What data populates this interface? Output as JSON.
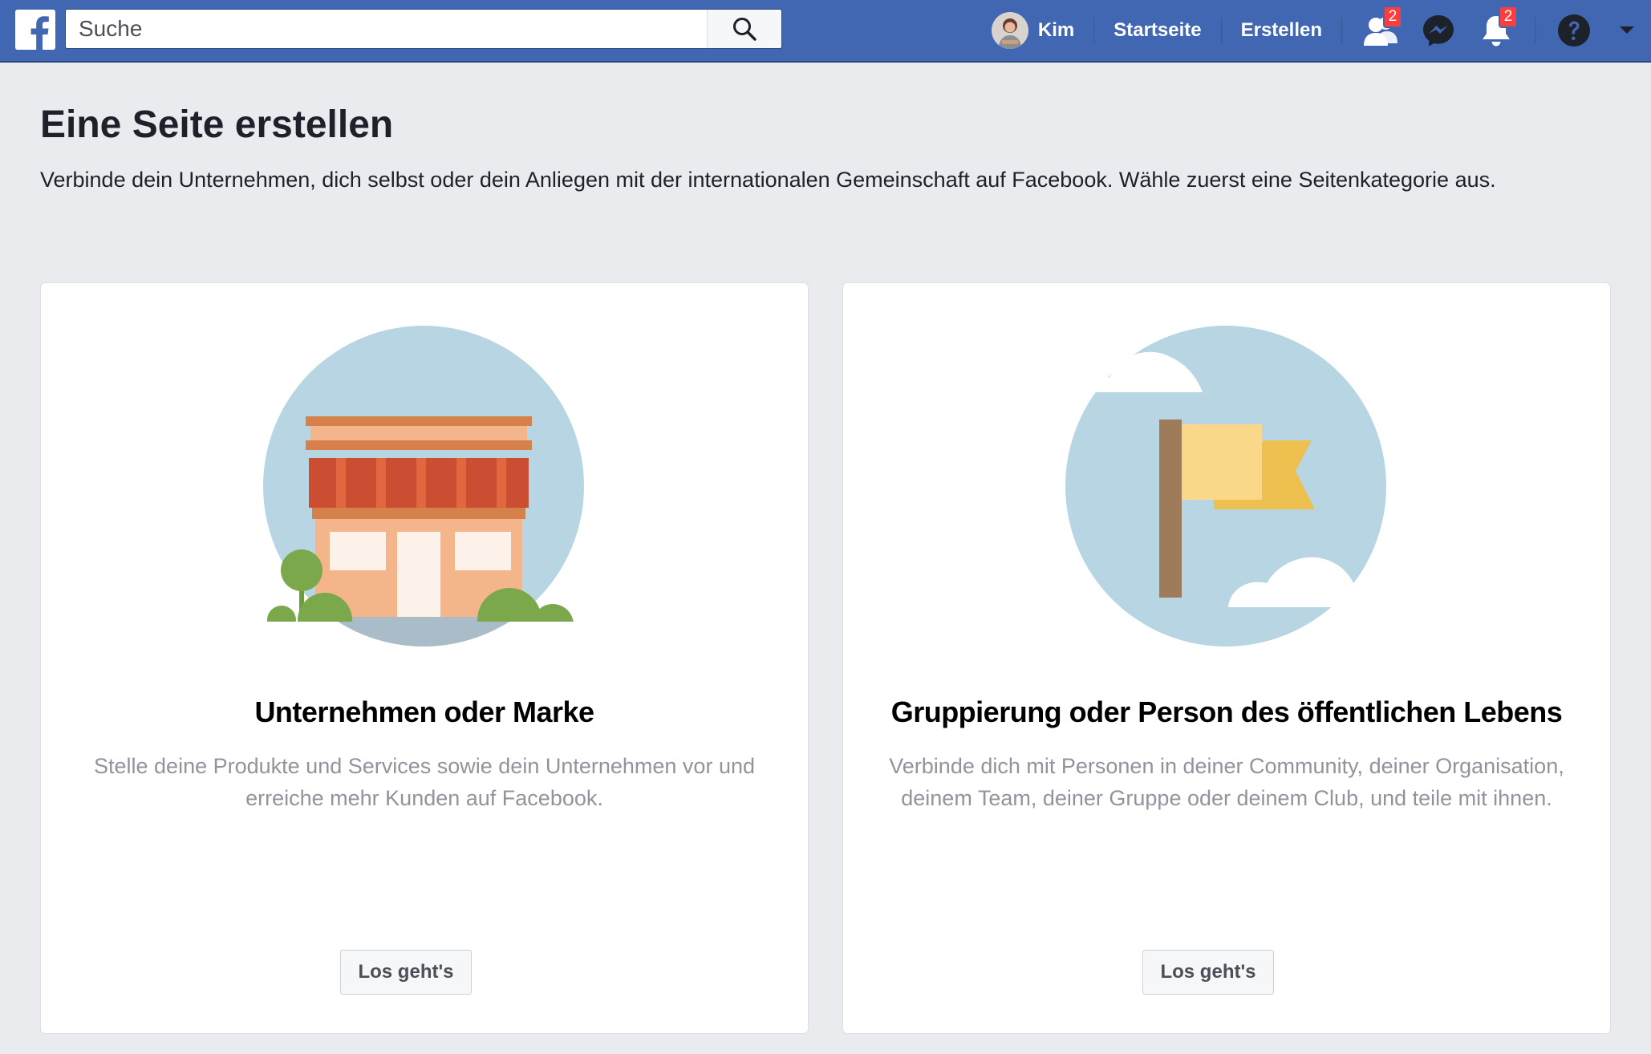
{
  "header": {
    "search_placeholder": "Suche",
    "profile_name": "Kim",
    "nav_home": "Startseite",
    "nav_create": "Erstellen",
    "friend_requests_count": "2",
    "notifications_count": "2",
    "colors": {
      "bar": "#4267b2",
      "badge": "#fa3e3e"
    },
    "icons": [
      "facebook-logo-icon",
      "search-icon",
      "friend-requests-icon",
      "messenger-icon",
      "notifications-bell-icon",
      "help-icon",
      "caret-down-icon"
    ]
  },
  "page": {
    "title": "Eine Seite erstellen",
    "subtitle": "Verbinde dein Unternehmen, dich selbst oder dein Anliegen mit der internationalen Gemeinschaft auf Facebook. Wähle zuerst eine Seitenkategorie aus."
  },
  "cards": [
    {
      "title": "Unternehmen oder Marke",
      "description": "Stelle deine Produkte und Services sowie dein Unternehmen vor und erreiche mehr Kunden auf Facebook.",
      "button": "Los geht's",
      "illustration": "storefront-illustration"
    },
    {
      "title": "Gruppierung oder Person des öffentlichen Lebens",
      "description": "Verbinde dich mit Personen in deiner Community, deiner Organisation, deinem Team, deiner Gruppe oder deinem Club, und teile mit ihnen.",
      "button": "Los geht's",
      "illustration": "flag-illustration"
    }
  ]
}
